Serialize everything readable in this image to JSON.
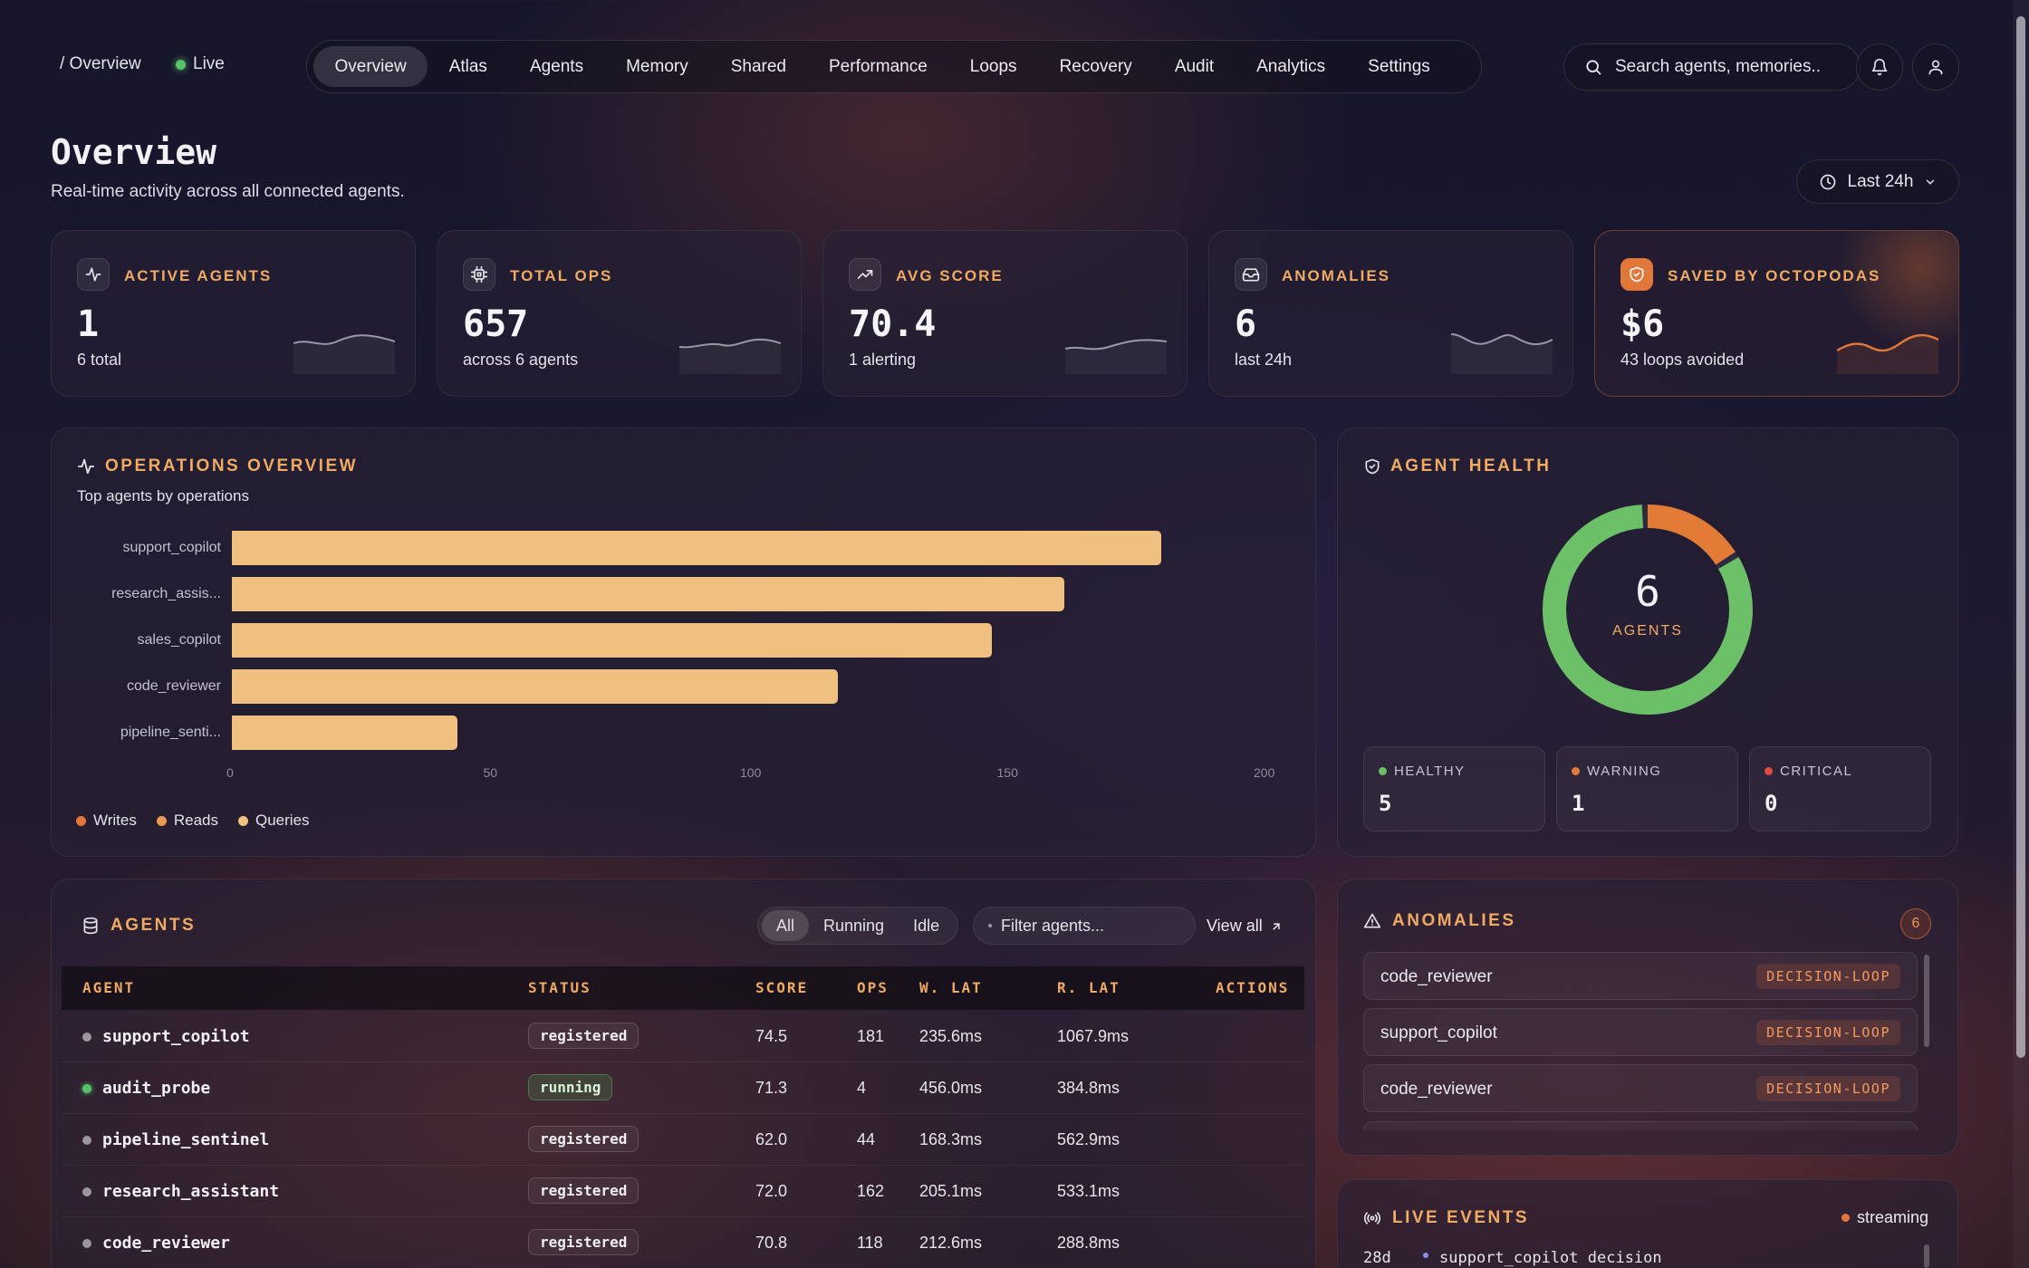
{
  "topbar": {
    "breadcrumb": "/ Overview",
    "live_label": "Live",
    "nav": [
      "Overview",
      "Atlas",
      "Agents",
      "Memory",
      "Shared",
      "Performance",
      "Loops",
      "Recovery",
      "Audit",
      "Analytics",
      "Settings"
    ],
    "active_nav": "Overview",
    "search_placeholder": "Search agents, memories.."
  },
  "header": {
    "title": "Overview",
    "subtitle": "Real-time activity across all connected agents.",
    "time_range": "Last 24h"
  },
  "stats": [
    {
      "label": "ACTIVE AGENTS",
      "value": "1",
      "sub": "6 total",
      "icon": "activity-icon"
    },
    {
      "label": "TOTAL OPS",
      "value": "657",
      "sub": "across 6 agents",
      "icon": "cpu-icon"
    },
    {
      "label": "AVG SCORE",
      "value": "70.4",
      "sub": "1 alerting",
      "icon": "trending-up-icon"
    },
    {
      "label": "ANOMALIES",
      "value": "6",
      "sub": "last 24h",
      "icon": "inbox-icon"
    },
    {
      "label": "SAVED BY OCTOPODAS",
      "value": "$6",
      "sub": "43 loops avoided",
      "icon": "shield-check-icon"
    }
  ],
  "operations": {
    "title": "OPERATIONS OVERVIEW",
    "subtitle": "Top agents by operations",
    "legend": [
      "Writes",
      "Reads",
      "Queries"
    ]
  },
  "chart_data": {
    "type": "bar",
    "orientation": "horizontal",
    "categories": [
      "support_copilot",
      "research_assis...",
      "sales_copilot",
      "code_reviewer",
      "pipeline_senti..."
    ],
    "values": [
      181,
      162,
      148,
      118,
      44
    ],
    "xlim": [
      0,
      200
    ],
    "xticks": [
      0,
      50,
      100,
      150,
      200
    ],
    "color": "#f0c080"
  },
  "health": {
    "title": "AGENT HEALTH",
    "total": "6",
    "total_label": "AGENTS",
    "healthy_label": "HEALTHY",
    "healthy": "5",
    "warning_label": "WARNING",
    "warning": "1",
    "critical_label": "CRITICAL",
    "critical": "0",
    "colors": {
      "healthy": "#6cc067",
      "warning": "#e27b35",
      "critical": "#e24a3f"
    }
  },
  "agents": {
    "title": "AGENTS",
    "filters": [
      "All",
      "Running",
      "Idle"
    ],
    "filter_placeholder": "Filter agents...",
    "view_all": "View all",
    "columns": [
      "AGENT",
      "STATUS",
      "SCORE",
      "OPS",
      "W. LAT",
      "R. LAT",
      "ACTIONS"
    ],
    "rows": [
      {
        "name": "support_copilot",
        "status": "registered",
        "score": "74.5",
        "ops": "181",
        "wlat": "235.6ms",
        "rlat": "1067.9ms"
      },
      {
        "name": "audit_probe",
        "status": "running",
        "score": "71.3",
        "ops": "4",
        "wlat": "456.0ms",
        "rlat": "384.8ms"
      },
      {
        "name": "pipeline_sentinel",
        "status": "registered",
        "score": "62.0",
        "ops": "44",
        "wlat": "168.3ms",
        "rlat": "562.9ms"
      },
      {
        "name": "research_assistant",
        "status": "registered",
        "score": "72.0",
        "ops": "162",
        "wlat": "205.1ms",
        "rlat": "533.1ms"
      },
      {
        "name": "code_reviewer",
        "status": "registered",
        "score": "70.8",
        "ops": "118",
        "wlat": "212.6ms",
        "rlat": "288.8ms"
      }
    ]
  },
  "anomalies": {
    "title": "ANOMALIES",
    "count": "6",
    "items": [
      {
        "agent": "code_reviewer",
        "type": "DECISION-LOOP"
      },
      {
        "agent": "support_copilot",
        "type": "DECISION-LOOP"
      },
      {
        "agent": "code_reviewer",
        "type": "DECISION-LOOP"
      }
    ]
  },
  "live_events": {
    "title": "LIVE EVENTS",
    "status": "streaming",
    "first_time": "28d",
    "first_event": "support_copilot decision"
  }
}
